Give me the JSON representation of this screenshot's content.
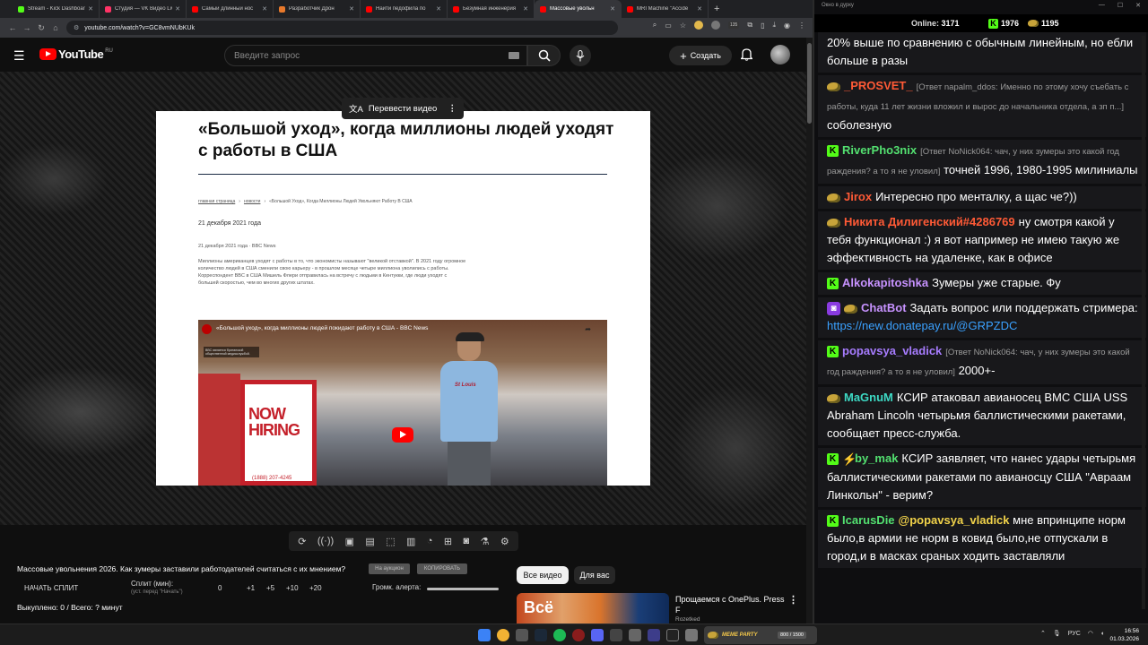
{
  "browser": {
    "tabs": [
      {
        "title": "Stream - Kick Dashboard",
        "color": "#53fc18"
      },
      {
        "title": "Студия — VK Видео Live",
        "color": "#ff3366"
      },
      {
        "title": "Самый длинный нос",
        "color": "#ff0000"
      },
      {
        "title": "Разработчик Дрон",
        "color": "#e8792b"
      },
      {
        "title": "Найти педофила по",
        "color": "#ff0000"
      },
      {
        "title": "Безумная инженерия",
        "color": "#ff0000"
      },
      {
        "title": "Массовые увольн",
        "color": "#ff0000",
        "active": true
      },
      {
        "title": "MRI Machine \"Accide",
        "color": "#ff0000"
      }
    ],
    "url": "youtube.com/watch?v=GC8vmNUbKUk",
    "notif_count": "135"
  },
  "youtube": {
    "logo": "YouTube",
    "region": "RU",
    "search_placeholder": "Введите запрос",
    "create_label": "Создать",
    "translate_label": "Перевести видео",
    "video_title": "Массовые увольнения 2026. Как зумеры заставили работодателей считаться с их мнением?",
    "chip_all": "Все видео",
    "chip_foryou": "Для вас",
    "rec_title": "Прощаемся с OnePlus. Press F",
    "rec_channel": "Rozetked",
    "rec_thumb_word": "Всё"
  },
  "article": {
    "title": "«Большой уход», когда миллионы людей уходят с работы в США",
    "crumbs": [
      "главная страница",
      "новости",
      "«Большой Уход», Когда Миллионы Людей Увольняют Работу В США"
    ],
    "date": "21 декабря 2021 года",
    "date_source": "21 декабря 2021 года · BBC News",
    "body": "Миллионы американцев уходят с работы в то, что экономисты называют \"великой отставкой\". В 2021 году огромное количество людей в США сменили свою карьеру - в прошлом месяце четыре миллиона уволились с работы. Корреспондент BBC в США Мишель Флери отправилась на встречу с людьми в Кентукки, где люди уходят с большей скоростью, чем во многих других штатах.",
    "embed_title": "«Большой уход», когда миллионы людей покидают работу в США - BBC News",
    "embed_note": "BBC является британской общественной медиаслужбой.",
    "sign_text": "NOW HIRING",
    "sign_phone": "(1888) 207-4245",
    "jersey_text": "St Louis"
  },
  "controls": {
    "buy_btn": "На аукцион",
    "copy_btn": "КОПИРОВАТЬ",
    "start_split": "НАЧАТЬ СПЛИТ",
    "split_label": "Сплит (мин):",
    "split_sub": "(уст. перед \"Начать\")",
    "split_value": "0",
    "plus1": "+1",
    "plus5": "+5",
    "plus10": "+10",
    "plus20": "+20",
    "alert_label": "Громк. алерта:",
    "bought": "Выкуплено: 0 / Всего: ? минут"
  },
  "chat": {
    "window_title": "Окно в дурку",
    "online_label": "Online:",
    "online": "3171",
    "kick_count": "1976",
    "other_count": "1195",
    "messages": [
      {
        "badges": [],
        "nick": "",
        "color": "#fff",
        "reply": "",
        "text": "20% выше по сравнению с обычным линейным, но ебли больше в разы"
      },
      {
        "badges": [
          "c"
        ],
        "nick": "_PROSVET_",
        "color": "#ff5a36",
        "reply": "[Ответ napalm_ddos: Именно по этому хочу съебать с работы, куда 11 лет жизни вложил и вырос до начальника отдела, а зп п...]",
        "text": "соболезную"
      },
      {
        "badges": [
          "k"
        ],
        "nick": "RiverPho3nix",
        "color": "#53e070",
        "reply": "[Ответ NoNick064: чач, у них зумеры это какой год раждения? а то я не уловил]",
        "text": "точней 1996, 1980-1995 милиниалы"
      },
      {
        "badges": [
          "c"
        ],
        "nick": "Jirox",
        "color": "#ff5a36",
        "reply": "",
        "text": "Интересно про менталку, а щас че?))"
      },
      {
        "badges": [
          "c"
        ],
        "nick": "Никита Дилигенский#4286769",
        "color": "#ff5a36",
        "reply": "",
        "text": "ну смотря какой у тебя функционал :) я вот например не имею такую же эффективность на удаленке, как в офисе"
      },
      {
        "badges": [
          "k"
        ],
        "nick": "Alkokapitoshka",
        "color": "#c792ff",
        "reply": "",
        "text": "Зумеры уже старые. Фу"
      },
      {
        "badges": [
          "bot",
          "c"
        ],
        "nick": "ChatBot",
        "color": "#c792ff",
        "reply": "",
        "text": "Задать вопрос или поддержать стримера:",
        "link": "https://new.donatepay.ru/@GRPZDC"
      },
      {
        "badges": [
          "k"
        ],
        "nick": "popavsya_vladick",
        "color": "#a77cff",
        "reply": "[Ответ NoNick064: чач, у них зумеры это какой год раждения? а то я не уловил]",
        "text": "2000+-"
      },
      {
        "badges": [
          "c"
        ],
        "nick": "MaGnuM",
        "color": "#3dd9c4",
        "reply": "",
        "text": "КСИР атаковал авианосец ВМС США USS Abraham Lincoln четырьмя баллистическими ракетами, сообщает пресс-служба."
      },
      {
        "badges": [
          "k",
          "bolt"
        ],
        "nick": "by_mak",
        "color": "#53e070",
        "reply": "",
        "text": "КСИР заявляет, что нанес удары четырьмя баллистическими ракетами по авианосцу США \"Авраам Линкольн\" - верим?"
      },
      {
        "badges": [
          "k"
        ],
        "nick": "IcarusDie",
        "color": "#53e070",
        "reply": "",
        "mention": "@popavsya_vladick",
        "text": "мне впринципе норм было,в армии не норм в ковид было,не отпускали в город,и в масках сраных ходить заставляли"
      }
    ]
  },
  "taskbar": {
    "meme_label": "MEME PARTY",
    "meme_count": "800 / 1500",
    "lang": "РУС",
    "time": "16:56",
    "date": "01.03.2026"
  }
}
